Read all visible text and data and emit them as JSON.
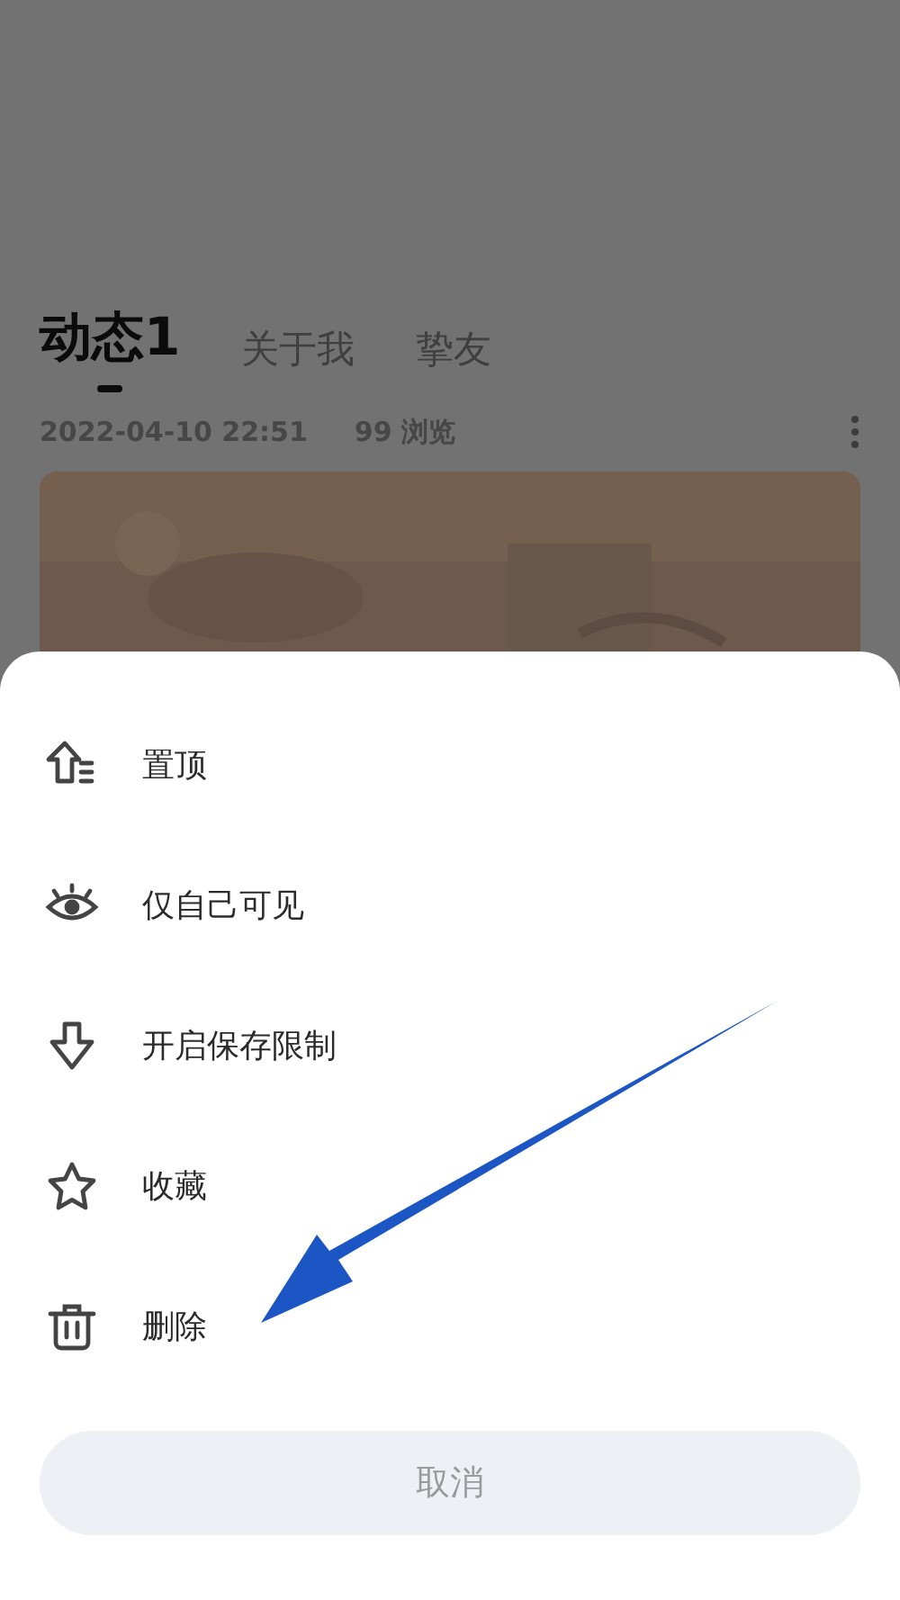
{
  "tabs": [
    {
      "label": "动态1",
      "selected": true
    },
    {
      "label": "关于我",
      "selected": false
    },
    {
      "label": "挚友",
      "selected": false
    }
  ],
  "post": {
    "date": "2022-04-10  22:51",
    "views": "99 浏览"
  },
  "sheet": {
    "items": [
      {
        "kind": "pin-top",
        "label": "置顶"
      },
      {
        "kind": "eye",
        "label": "仅自己可见"
      },
      {
        "kind": "down-arrow",
        "label": "开启保存限制"
      },
      {
        "kind": "star",
        "label": "收藏"
      },
      {
        "kind": "trash",
        "label": "删除"
      }
    ],
    "cancel": "取消"
  }
}
